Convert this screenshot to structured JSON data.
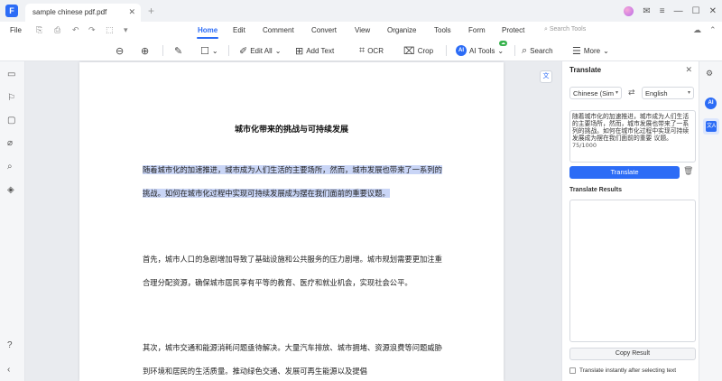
{
  "titlebar": {
    "app_logo": "F",
    "tab_title": "sample chinese pdf.pdf",
    "tab_close": "✕",
    "tab_add": "+"
  },
  "menubar": {
    "file": "File",
    "tabs": [
      {
        "label": "Home",
        "active": true
      },
      {
        "label": "Edit"
      },
      {
        "label": "Comment"
      },
      {
        "label": "Convert"
      },
      {
        "label": "View"
      },
      {
        "label": "Organize"
      },
      {
        "label": "Tools"
      },
      {
        "label": "Form"
      },
      {
        "label": "Protect"
      }
    ],
    "search_tools": "Search Tools"
  },
  "toolbar": {
    "edit_all": "Edit All",
    "add_text": "Add Text",
    "ocr": "OCR",
    "crop": "Crop",
    "ai_tools": "AI Tools",
    "ai_badge": "AI",
    "search": "Search",
    "more": "More"
  },
  "document": {
    "title": "城市化带来的挑战与可持续发展",
    "paragraphs": [
      "随着城市化的加速推进，城市成为人们生活的主要场所，然而，城市发展也带来了一系列的挑战。如何在城市化过程中实现可持续发展成为摆在我们面前的重要议题。",
      "首先，城市人口的急剧增加导致了基础设施和公共服务的压力剧增。城市规划需要更加注重合理分配资源，确保城市居民享有平等的教育、医疗和就业机会，实现社会公平。",
      "其次，城市交通和能源消耗问题亟待解决。大量汽车排放、城市拥堵、资源浪费等问题威胁到环境和居民的生活质量。推动绿色交通、发展可再生能源以及提倡"
    ]
  },
  "translate_panel": {
    "title": "Translate",
    "from_lang": "Chinese (Sim",
    "to_lang": "English",
    "source_text": "随着城市化的加速推进，城市成为人们生活的主要场所，然而，城市发展也带来了一系列的挑战。如何在城市化过程中实现可持续发展成为摆在我们面前的重要 议题。",
    "char_count": "75/1000",
    "translate_button": "Translate",
    "results_label": "Translate Results",
    "copy_button": "Copy Result",
    "instant_label": "Translate instantly after selecting text"
  },
  "right_rail": {
    "ai_label": "AI",
    "translate_label": "文A"
  },
  "colors": {
    "accent": "#2c6cf6",
    "highlight": "#c9d5f6"
  }
}
